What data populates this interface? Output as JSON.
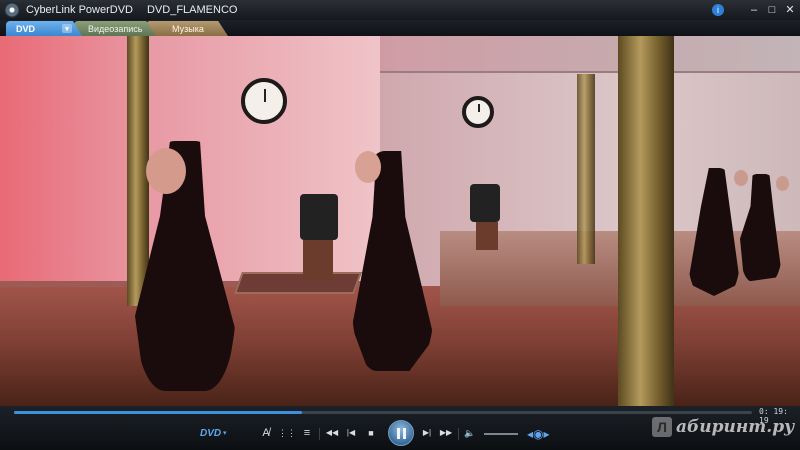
{
  "window": {
    "app_title": "CyberLink PowerDVD",
    "media_title": "DVD_FLAMENCO",
    "controls": {
      "info": "i",
      "minimize": "–",
      "maximize": "□",
      "close": "✕"
    }
  },
  "tabs": [
    {
      "label": "DVD",
      "active": true,
      "dropdown": "▾"
    },
    {
      "label": "Видеозапись",
      "active": false
    },
    {
      "label": "Музыка",
      "active": false
    }
  ],
  "video": {
    "scene": "flamenco-dance-studio"
  },
  "playback": {
    "progress_fraction": 0.39,
    "time": "0: 19: 19",
    "source_label": "DVD",
    "source_caret": "▾",
    "volume_fraction": 0.0
  },
  "toolbar": {
    "audio_icon": "A̸",
    "menu_icon": "⋮⋮",
    "settings_icon": "≡",
    "rewind_icon": "◀◀",
    "previous_icon": "|◀",
    "stop_icon": "■",
    "next_icon": "▶|",
    "forward_icon": "▶▶",
    "volume_icon": "🔈",
    "view_icon": "◂◉▸"
  },
  "watermark": {
    "logo": "Л",
    "text": "абиринт.ру"
  },
  "colors": {
    "accent": "#3f8fe0",
    "tab_dvd": "#4e9ae0",
    "tab_video": "#73875f",
    "tab_music": "#a0845a"
  }
}
